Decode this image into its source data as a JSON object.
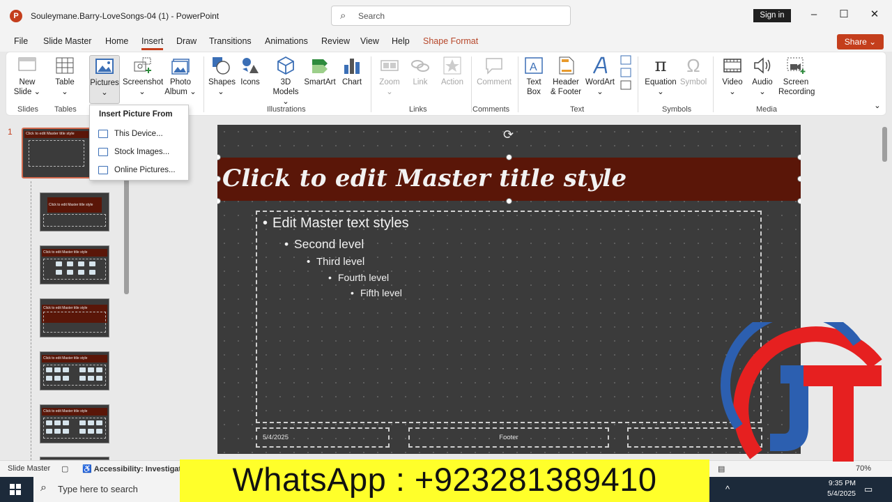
{
  "window": {
    "title": "Souleymane.Barry-LoveSongs-04 (1)  -  PowerPoint",
    "app_logo_letter": "P",
    "search_placeholder": "Search",
    "signin": "Sign in",
    "min": "–",
    "max": "☐",
    "close": "✕"
  },
  "menu": {
    "tabs": [
      "File",
      "Slide Master",
      "Home",
      "Insert",
      "Draw",
      "Transitions",
      "Animations",
      "Review",
      "View",
      "Help",
      "Shape Format"
    ],
    "active": "Insert",
    "share": "Share"
  },
  "ribbon": {
    "new_slide": "New Slide",
    "table": "Table",
    "pictures": "Pictures",
    "screenshot": "Screenshot",
    "photo_album": "Photo Album",
    "shapes": "Shapes",
    "icons": "Icons",
    "models_3d": "3D Models",
    "smartart": "SmartArt",
    "chart": "Chart",
    "zoom": "Zoom",
    "link": "Link",
    "action": "Action",
    "comment": "Comment",
    "text_box": "Text Box",
    "header_footer": "Header & Footer",
    "wordart": "WordArt",
    "equation": "Equation",
    "symbol": "Symbol",
    "video": "Video",
    "audio": "Audio",
    "screen_recording": "Screen Recording",
    "groups": {
      "slides": "Slides",
      "tables": "Tables",
      "illustrations": "Illustrations",
      "links": "Links",
      "comments": "Comments",
      "text": "Text",
      "symbols": "Symbols",
      "media": "Media"
    }
  },
  "dropdown": {
    "heading": "Insert Picture From",
    "items": [
      "This Device...",
      "Stock Images...",
      "Online Pictures..."
    ]
  },
  "thumbnails": {
    "first_number": "1",
    "title_text": "Click to edit Master title style"
  },
  "slide": {
    "title": "Click to edit Master title style",
    "levels": [
      "Edit Master text styles",
      "Second level",
      "Third level",
      "Fourth level",
      "Fifth level"
    ],
    "date": "5/4/2025",
    "footer": "Footer"
  },
  "statusbar": {
    "view": "Slide Master",
    "accessibility": "Accessibility: Investigate",
    "zoom": "70%"
  },
  "banner": {
    "text": "WhatsApp : +923281389410"
  },
  "taskbar": {
    "search_placeholder": "Type here to search",
    "time": "9:35 PM",
    "date": "5/4/2025"
  },
  "colors": {
    "accent": "#c43e1c",
    "title_band": "#5a1608",
    "slide_bg": "#3b3b3b",
    "banner": "#ffff2a"
  }
}
